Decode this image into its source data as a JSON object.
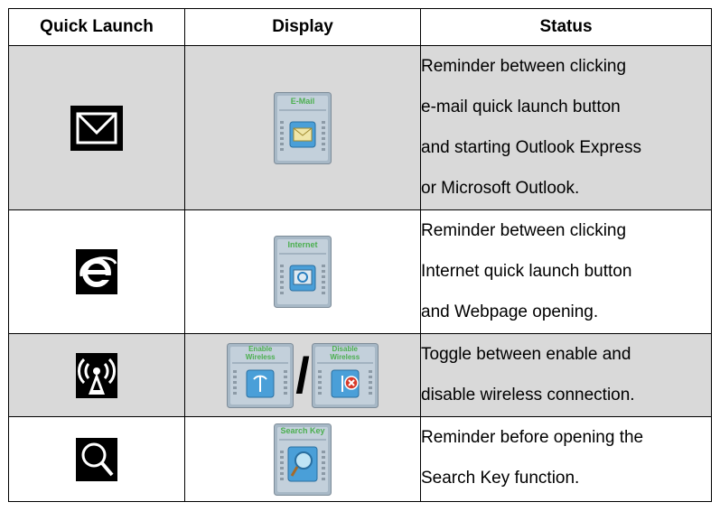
{
  "table": {
    "headers": [
      "Quick Launch",
      "Display",
      "Status"
    ],
    "rows": [
      {
        "launch_icon": "envelope-icon",
        "display_titles": [
          "E-Mail"
        ],
        "status_lines": [
          "Reminder between clicking",
          "e-mail quick launch button",
          "and starting Outlook Express",
          "or Microsoft Outlook."
        ]
      },
      {
        "launch_icon": "internet-explorer-icon",
        "display_titles": [
          "Internet"
        ],
        "status_lines": [
          "Reminder between clicking",
          "Internet quick launch button",
          "and Webpage opening."
        ]
      },
      {
        "launch_icon": "wireless-antenna-icon",
        "display_titles": [
          "Enable Wireless",
          "Disable Wireless"
        ],
        "separator": "/",
        "status_lines": [
          "Toggle between enable and",
          "disable wireless connection."
        ]
      },
      {
        "launch_icon": "magnifier-icon",
        "display_titles": [
          "Search Key"
        ],
        "status_lines": [
          "Reminder before opening the",
          "Search Key function."
        ]
      }
    ]
  },
  "colors": {
    "gray_row": "#d9d9d9",
    "border": "#000000",
    "panel_title": "#4caf50"
  }
}
